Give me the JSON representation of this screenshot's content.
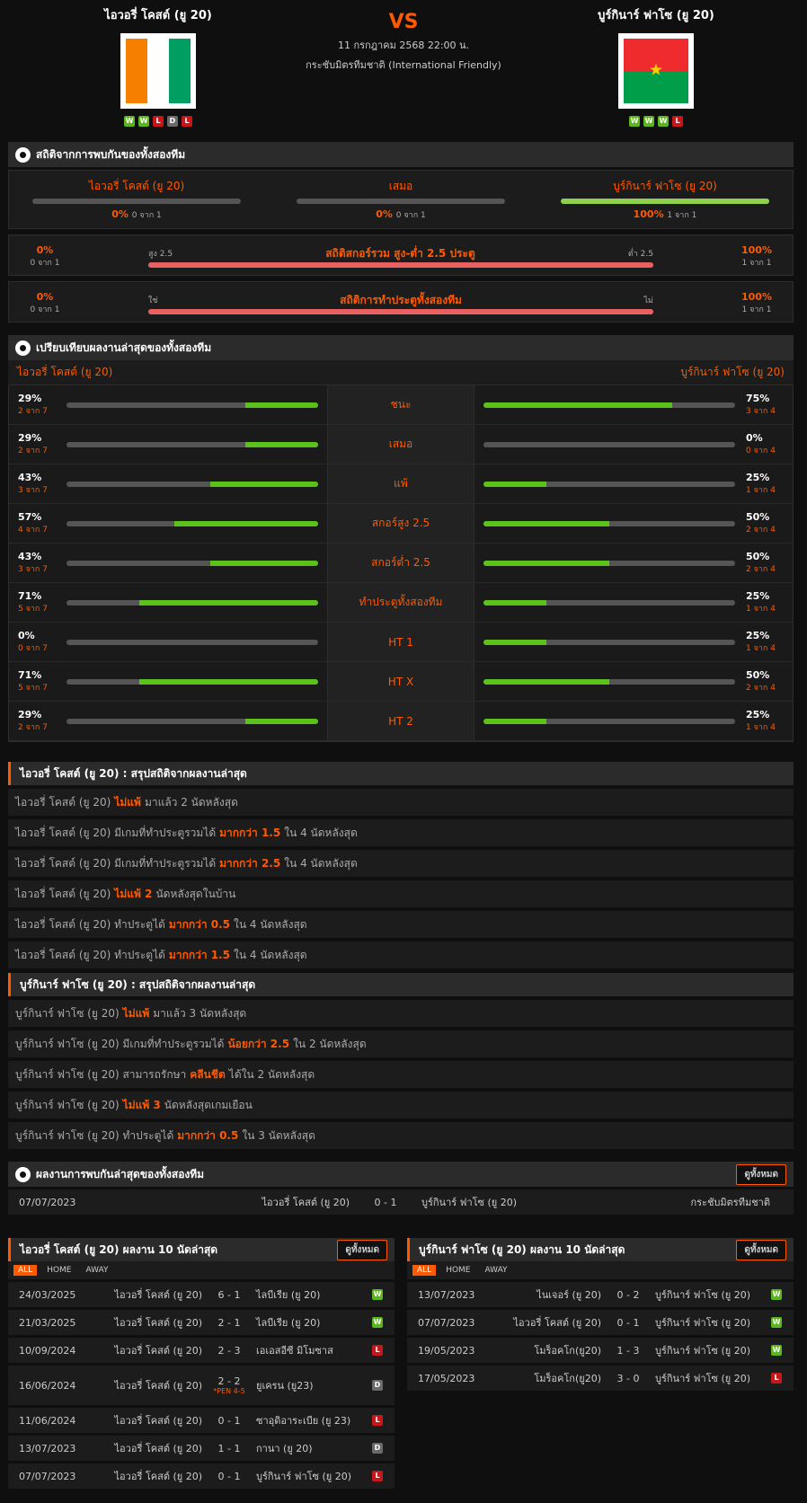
{
  "match": {
    "vs": "VS",
    "datetime": "11 กรกฎาคม 2568 22:00 น.",
    "competition": "กระชับมิตรทีมชาติ (International Friendly)",
    "home": {
      "name": "ไอวอรี่ โคสต์ (ยู 20)",
      "form": [
        "W",
        "W",
        "L",
        "D",
        "L"
      ],
      "flag_colors": [
        "#f77f00",
        "#ffffff",
        "#009e60"
      ]
    },
    "away": {
      "name": "บูร์กินาร์ ฟาโซ (ยู 20)",
      "form": [
        "W",
        "W",
        "W",
        "L"
      ],
      "flag_colors": [
        "#ef2b2d",
        "#009e49",
        "#fcd116"
      ]
    }
  },
  "h2h_stats": {
    "title": "สถิติจากการพบกันของทั้งสองทีม",
    "home": {
      "label": "ไอวอรี่ โคสต์ (ยู 20)",
      "pct": "0%",
      "count": "0 จาก 1"
    },
    "draw": {
      "label": "เสมอ",
      "pct": "0%",
      "count": "0 จาก 1"
    },
    "away": {
      "label": "บูร์กินาร์ ฟาโซ (ยู 20)",
      "pct": "100%",
      "count": "1 จาก 1"
    },
    "ou": {
      "title": "สถิติสกอร์รวม สูง-ต่ำ 2.5 ประตู",
      "left_label": "สูง 2.5",
      "right_label": "ต่ำ 2.5",
      "left_pct": "0%",
      "left_count": "0 จาก 1",
      "right_pct": "100%",
      "right_count": "1 จาก 1"
    },
    "btts": {
      "title": "สถิติการทำประตูทั้งสองทีม",
      "left_label": "ใช่",
      "right_label": "ไม่",
      "left_pct": "0%",
      "left_count": "0 จาก 1",
      "right_pct": "100%",
      "right_count": "1 จาก 1"
    }
  },
  "compare": {
    "title": "เปรียบเทียบผลงานล่าสุดของทั้งสองทีม",
    "home_label": "ไอวอรี่ โคสต์ (ยู 20)",
    "away_label": "บูร์กินาร์ ฟาโซ (ยู 20)",
    "rows": [
      {
        "label": "ชนะ",
        "hp": "29%",
        "hc": "2 จาก 7",
        "hv": 0.29,
        "ap": "75%",
        "ac": "3 จาก 4",
        "av": 0.75
      },
      {
        "label": "เสมอ",
        "hp": "29%",
        "hc": "2 จาก 7",
        "hv": 0.29,
        "ap": "0%",
        "ac": "0 จาก 4",
        "av": 0
      },
      {
        "label": "แพ้",
        "hp": "43%",
        "hc": "3 จาก 7",
        "hv": 0.43,
        "ap": "25%",
        "ac": "1 จาก 4",
        "av": 0.25
      },
      {
        "label": "สกอร์สูง 2.5",
        "hp": "57%",
        "hc": "4 จาก 7",
        "hv": 0.57,
        "ap": "50%",
        "ac": "2 จาก 4",
        "av": 0.5
      },
      {
        "label": "สกอร์ต่ำ 2.5",
        "hp": "43%",
        "hc": "3 จาก 7",
        "hv": 0.43,
        "ap": "50%",
        "ac": "2 จาก 4",
        "av": 0.5
      },
      {
        "label": "ทำประตูทั้งสองทีม",
        "hp": "71%",
        "hc": "5 จาก 7",
        "hv": 0.71,
        "ap": "25%",
        "ac": "1 จาก 4",
        "av": 0.25
      },
      {
        "label": "HT 1",
        "hp": "0%",
        "hc": "0 จาก 7",
        "hv": 0,
        "ap": "25%",
        "ac": "1 จาก 4",
        "av": 0.25
      },
      {
        "label": "HT X",
        "hp": "71%",
        "hc": "5 จาก 7",
        "hv": 0.71,
        "ap": "50%",
        "ac": "2 จาก 4",
        "av": 0.5
      },
      {
        "label": "HT 2",
        "hp": "29%",
        "hc": "2 จาก 7",
        "hv": 0.29,
        "ap": "25%",
        "ac": "1 จาก 4",
        "av": 0.25
      }
    ]
  },
  "home_summary": {
    "title": "ไอวอรี่ โคสต์ (ยู 20) : สรุปสถิติจากผลงานล่าสุด",
    "rows": [
      [
        "ไอวอรี่ โคสต์ (ยู 20)",
        "ไม่แพ้",
        "มาแล้ว 2 นัดหลังสุด"
      ],
      [
        "ไอวอรี่ โคสต์ (ยู 20) มีเกมที่ทำประตูรวมได้",
        "มากกว่า 1.5",
        "ใน 4 นัดหลังสุด"
      ],
      [
        "ไอวอรี่ โคสต์ (ยู 20) มีเกมที่ทำประตูรวมได้",
        "มากกว่า 2.5",
        "ใน 4 นัดหลังสุด"
      ],
      [
        "ไอวอรี่ โคสต์ (ยู 20)",
        "ไม่แพ้ 2",
        "นัดหลังสุดในบ้าน"
      ],
      [
        "ไอวอรี่ โคสต์ (ยู 20) ทำประตูได้",
        "มากกว่า 0.5",
        "ใน 4 นัดหลังสุด"
      ],
      [
        "ไอวอรี่ โคสต์ (ยู 20) ทำประตูได้",
        "มากกว่า 1.5",
        "ใน 4 นัดหลังสุด"
      ]
    ]
  },
  "away_summary": {
    "title": "บูร์กินาร์ ฟาโซ (ยู 20) : สรุปสถิติจากผลงานล่าสุด",
    "rows": [
      [
        "บูร์กินาร์ ฟาโซ (ยู 20)",
        "ไม่แพ้",
        "มาแล้ว 3 นัดหลังสุด"
      ],
      [
        "บูร์กินาร์ ฟาโซ (ยู 20) มีเกมที่ทำประตูรวมได้",
        "น้อยกว่า 2.5",
        "ใน 2 นัดหลังสุด"
      ],
      [
        "บูร์กินาร์ ฟาโซ (ยู 20) สามารถรักษา",
        "คลีนชีต",
        "ได้ใน 2 นัดหลังสุด"
      ],
      [
        "บูร์กินาร์ ฟาโซ (ยู 20)",
        "ไม่แพ้ 3",
        "นัดหลังสุดเกมเยือน"
      ],
      [
        "บูร์กินาร์ ฟาโซ (ยู 20) ทำประตูได้",
        "มากกว่า 0.5",
        "ใน 3 นัดหลังสุด"
      ]
    ]
  },
  "h2h_results": {
    "title": "ผลงานการพบกันล่าสุดของทั้งสองทีม",
    "view_all": "ดูทั้งหมด",
    "rows": [
      {
        "date": "07/07/2023",
        "home": "ไอวอรี่ โคสต์ (ยู 20)",
        "score": "0 - 1",
        "away": "บูร์กินาร์ ฟาโซ (ยู 20)",
        "comp": "กระชับมิตรทีมชาติ"
      }
    ]
  },
  "home_last10": {
    "title": "ไอวอรี่ โคสต์ (ยู 20) ผลงาน 10 นัดล่าสุด",
    "view_all": "ดูทั้งหมด",
    "tabs": [
      "ALL",
      "HOME",
      "AWAY"
    ],
    "rows": [
      {
        "date": "24/03/2025",
        "home": "ไอวอรี่ โคสต์ (ยู 20)",
        "score": "6 - 1",
        "away": "ไลบีเรีย (ยู 20)",
        "res": "W",
        "pen": ""
      },
      {
        "date": "21/03/2025",
        "home": "ไอวอรี่ โคสต์ (ยู 20)",
        "score": "2 - 1",
        "away": "ไลบีเรีย (ยู 20)",
        "res": "W",
        "pen": ""
      },
      {
        "date": "10/09/2024",
        "home": "ไอวอรี่ โคสต์ (ยู 20)",
        "score": "2 - 3",
        "away": "เอเอสอีซี มิโมซาส",
        "res": "L",
        "pen": ""
      },
      {
        "date": "16/06/2024",
        "home": "ไอวอรี่ โคสต์ (ยู 20)",
        "score": "2 - 2",
        "away": "ยูเครน (ยู23)",
        "res": "D",
        "pen": "*PEN 4-5"
      },
      {
        "date": "11/06/2024",
        "home": "ไอวอรี่ โคสต์ (ยู 20)",
        "score": "0 - 1",
        "away": "ซาอุดิอาระเบีย (ยู 23)",
        "res": "L",
        "pen": ""
      },
      {
        "date": "13/07/2023",
        "home": "ไอวอรี่ โคสต์ (ยู 20)",
        "score": "1 - 1",
        "away": "กานา (ยู 20)",
        "res": "D",
        "pen": ""
      },
      {
        "date": "07/07/2023",
        "home": "ไอวอรี่ โคสต์ (ยู 20)",
        "score": "0 - 1",
        "away": "บูร์กินาร์ ฟาโซ (ยู 20)",
        "res": "L",
        "pen": ""
      }
    ]
  },
  "away_last10": {
    "title": "บูร์กินาร์ ฟาโซ (ยู 20) ผลงาน 10 นัดล่าสุด",
    "view_all": "ดูทั้งหมด",
    "tabs": [
      "ALL",
      "HOME",
      "AWAY"
    ],
    "rows": [
      {
        "date": "13/07/2023",
        "home": "ไนเจอร์ (ยู 20)",
        "score": "0 - 2",
        "away": "บูร์กินาร์ ฟาโซ (ยู 20)",
        "res": "W"
      },
      {
        "date": "07/07/2023",
        "home": "ไอวอรี่ โคสต์ (ยู 20)",
        "score": "0 - 1",
        "away": "บูร์กินาร์ ฟาโซ (ยู 20)",
        "res": "W"
      },
      {
        "date": "19/05/2023",
        "home": "โมร็อคโก(ยู20)",
        "score": "1 - 3",
        "away": "บูร์กินาร์ ฟาโซ (ยู 20)",
        "res": "W"
      },
      {
        "date": "17/05/2023",
        "home": "โมร็อคโก(ยู20)",
        "score": "3 - 0",
        "away": "บูร์กินาร์ ฟาโซ (ยู 20)",
        "res": "L"
      }
    ]
  }
}
